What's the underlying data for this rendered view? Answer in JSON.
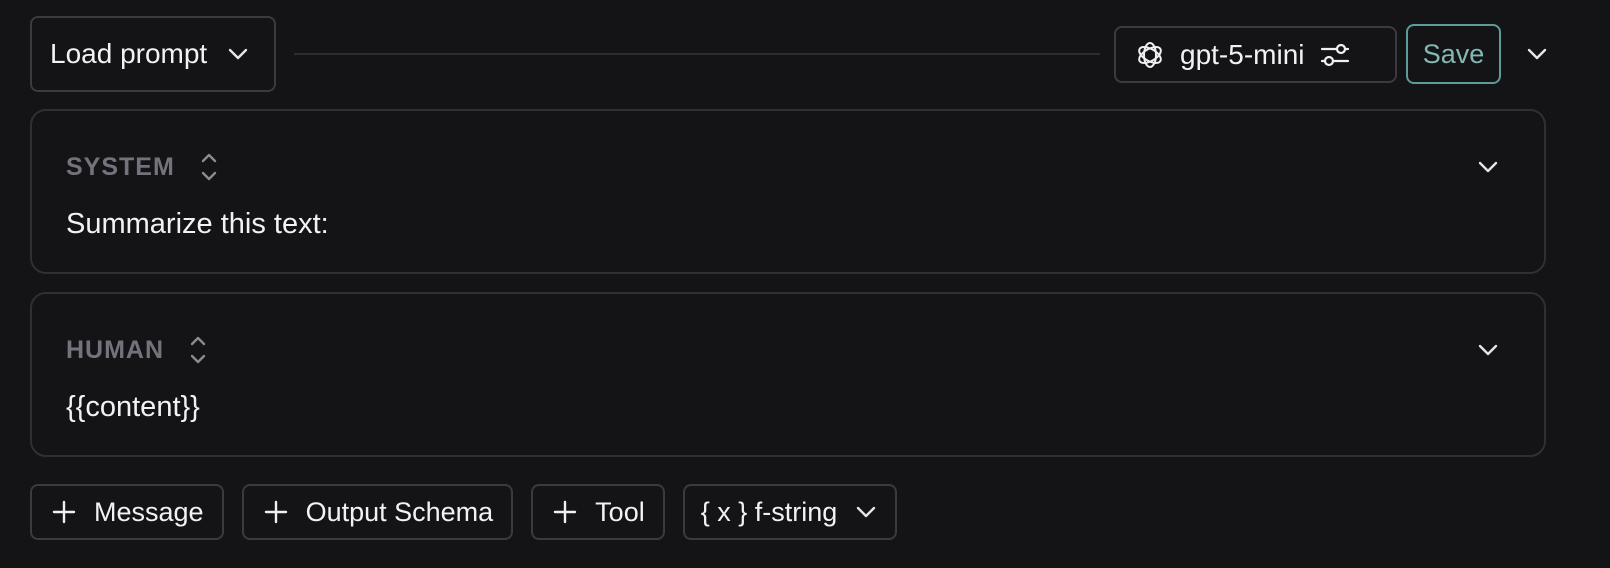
{
  "toolbar": {
    "load_prompt_label": "Load prompt",
    "model_name": "gpt-5-mini",
    "save_label": "Save",
    "icons": {
      "load_prompt_chevron": "chevron-down-icon",
      "model_logo": "openai-logo-icon",
      "model_settings": "sliders-icon",
      "more": "chevron-down-icon"
    },
    "save_color": "#83b8b3"
  },
  "messages": [
    {
      "role": "SYSTEM",
      "content": "Summarize this text:"
    },
    {
      "role": "HUMAN",
      "content": "{{content}}"
    }
  ],
  "actions": {
    "message_label": "Message",
    "output_schema_label": "Output Schema",
    "tool_label": "Tool",
    "template_format_label": "{ x } f-string"
  }
}
